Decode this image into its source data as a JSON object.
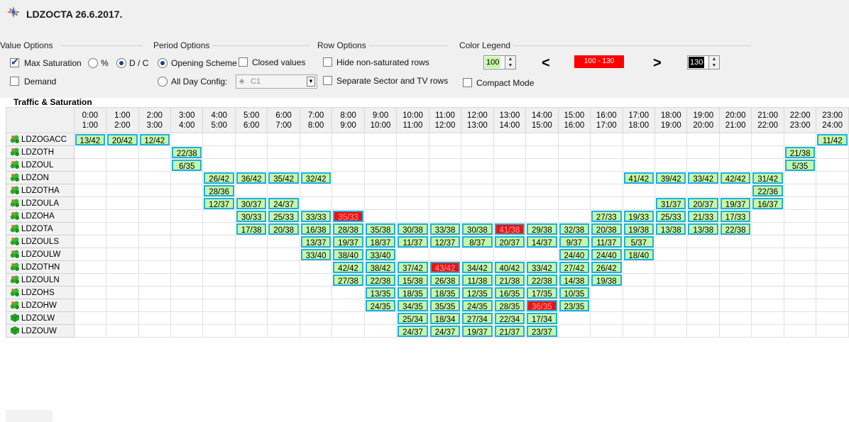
{
  "app": {
    "title": "LDZOCTA  26.6.2017."
  },
  "value_options": {
    "label": "Value Options",
    "max_saturation": "Max Saturation",
    "percent": "%",
    "dc": "D / C",
    "demand": "Demand"
  },
  "period_options": {
    "label": "Period Options",
    "opening_scheme": "Opening Scheme",
    "closed_values": "Closed values",
    "all_day_config": "All Day Config:",
    "config_value": "C1"
  },
  "row_options": {
    "label": "Row Options",
    "hide_rows": "Hide non-saturated rows",
    "separate_rows": "Separate Sector and TV rows"
  },
  "color_legend": {
    "label": "Color Legend",
    "low_value": "100",
    "less_than": "<",
    "range": "100 - 130",
    "greater_than": ">",
    "high_value": "130",
    "compact_mode": "Compact Mode",
    "cell_color": "#c6f7a9",
    "cell_border": "#19b1e0",
    "saturated_color": "#ee1111"
  },
  "table": {
    "title": "Traffic & Saturation",
    "hours": [
      [
        "0:00",
        "1:00"
      ],
      [
        "1:00",
        "2:00"
      ],
      [
        "2:00",
        "3:00"
      ],
      [
        "3:00",
        "4:00"
      ],
      [
        "4:00",
        "5:00"
      ],
      [
        "5:00",
        "6:00"
      ],
      [
        "6:00",
        "7:00"
      ],
      [
        "7:00",
        "8:00"
      ],
      [
        "8:00",
        "9:00"
      ],
      [
        "9:00",
        "10:00"
      ],
      [
        "10:00",
        "11:00"
      ],
      [
        "11:00",
        "12:00"
      ],
      [
        "12:00",
        "13:00"
      ],
      [
        "13:00",
        "14:00"
      ],
      [
        "14:00",
        "15:00"
      ],
      [
        "15:00",
        "16:00"
      ],
      [
        "16:00",
        "17:00"
      ],
      [
        "17:00",
        "18:00"
      ],
      [
        "18:00",
        "19:00"
      ],
      [
        "19:00",
        "20:00"
      ],
      [
        "20:00",
        "21:00"
      ],
      [
        "21:00",
        "22:00"
      ],
      [
        "22:00",
        "23:00"
      ],
      [
        "23:00",
        "24:00"
      ]
    ],
    "rows": [
      {
        "name": "LDZOGACC",
        "icon": "sector-group-icon",
        "cells": [
          "13/42",
          "20/42",
          "12/42",
          "",
          "",
          "",
          "",
          "",
          "",
          "",
          "",
          "",
          "",
          "",
          "",
          "",
          "",
          "",
          "",
          "",
          "",
          "",
          "",
          "11/42"
        ],
        "saturated": []
      },
      {
        "name": "LDZOTH",
        "icon": "sector-group-icon",
        "cells": [
          "",
          "",
          "",
          "22/38",
          "",
          "",
          "",
          "",
          "",
          "",
          "",
          "",
          "",
          "",
          "",
          "",
          "",
          "",
          "",
          "",
          "",
          "",
          "21/38",
          ""
        ],
        "saturated": []
      },
      {
        "name": "LDZOUL",
        "icon": "sector-group-icon",
        "cells": [
          "",
          "",
          "",
          "6/35",
          "",
          "",
          "",
          "",
          "",
          "",
          "",
          "",
          "",
          "",
          "",
          "",
          "",
          "",
          "",
          "",
          "",
          "",
          "5/35",
          ""
        ],
        "saturated": []
      },
      {
        "name": "LDZON",
        "icon": "sector-group-icon",
        "cells": [
          "",
          "",
          "",
          "",
          "26/42",
          "36/42",
          "35/42",
          "32/42",
          "",
          "",
          "",
          "",
          "",
          "",
          "",
          "",
          "",
          "41/42",
          "39/42",
          "33/42",
          "42/42",
          "31/42",
          "",
          ""
        ],
        "saturated": []
      },
      {
        "name": "LDZOTHA",
        "icon": "sector-group-icon",
        "cells": [
          "",
          "",
          "",
          "",
          "28/36",
          "",
          "",
          "",
          "",
          "",
          "",
          "",
          "",
          "",
          "",
          "",
          "",
          "",
          "",
          "",
          "",
          "22/36",
          "",
          ""
        ],
        "saturated": []
      },
      {
        "name": "LDZOULA",
        "icon": "sector-group-icon",
        "cells": [
          "",
          "",
          "",
          "",
          "12/37",
          "30/37",
          "24/37",
          "",
          "",
          "",
          "",
          "",
          "",
          "",
          "",
          "",
          "",
          "",
          "31/37",
          "20/37",
          "19/37",
          "16/37",
          "",
          ""
        ],
        "saturated": []
      },
      {
        "name": "LDZOHA",
        "icon": "sector-group-icon",
        "cells": [
          "",
          "",
          "",
          "",
          "",
          "30/33",
          "25/33",
          "33/33",
          "35/33",
          "",
          "",
          "",
          "",
          "",
          "",
          "",
          "27/33",
          "19/33",
          "25/33",
          "21/33",
          "17/33",
          "",
          "",
          ""
        ],
        "saturated": [
          8
        ]
      },
      {
        "name": "LDZOTA",
        "icon": "sector-group-icon",
        "cells": [
          "",
          "",
          "",
          "",
          "",
          "17/38",
          "20/38",
          "16/38",
          "28/38",
          "35/38",
          "30/38",
          "33/38",
          "30/38",
          "41/38",
          "29/38",
          "32/38",
          "20/38",
          "19/38",
          "13/38",
          "13/38",
          "22/38",
          "",
          "",
          ""
        ],
        "saturated": [
          13
        ]
      },
      {
        "name": "LDZOULS",
        "icon": "sector-group-icon",
        "cells": [
          "",
          "",
          "",
          "",
          "",
          "",
          "",
          "13/37",
          "19/37",
          "18/37",
          "11/37",
          "12/37",
          "8/37",
          "20/37",
          "14/37",
          "9/37",
          "11/37",
          "5/37",
          "",
          "",
          "",
          "",
          "",
          ""
        ],
        "saturated": []
      },
      {
        "name": "LDZOULW",
        "icon": "sector-group-icon",
        "cells": [
          "",
          "",
          "",
          "",
          "",
          "",
          "",
          "33/40",
          "38/40",
          "33/40",
          "",
          "",
          "",
          "",
          "",
          "24/40",
          "24/40",
          "18/40",
          "",
          "",
          "",
          "",
          "",
          ""
        ],
        "saturated": []
      },
      {
        "name": "LDZOTHN",
        "icon": "sector-group-icon",
        "cells": [
          "",
          "",
          "",
          "",
          "",
          "",
          "",
          "",
          "42/42",
          "38/42",
          "37/42",
          "43/42",
          "34/42",
          "40/42",
          "33/42",
          "27/42",
          "26/42",
          "",
          "",
          "",
          "",
          "",
          "",
          ""
        ],
        "saturated": [
          11
        ]
      },
      {
        "name": "LDZOULN",
        "icon": "sector-group-icon",
        "cells": [
          "",
          "",
          "",
          "",
          "",
          "",
          "",
          "",
          "27/38",
          "22/38",
          "15/38",
          "26/38",
          "11/38",
          "21/38",
          "22/38",
          "14/38",
          "19/38",
          "",
          "",
          "",
          "",
          "",
          "",
          ""
        ],
        "saturated": []
      },
      {
        "name": "LDZOHS",
        "icon": "sector-group-icon",
        "cells": [
          "",
          "",
          "",
          "",
          "",
          "",
          "",
          "",
          "",
          "13/35",
          "18/35",
          "18/35",
          "12/35",
          "16/35",
          "17/35",
          "10/35",
          "",
          "",
          "",
          "",
          "",
          "",
          "",
          ""
        ],
        "saturated": []
      },
      {
        "name": "LDZOHW",
        "icon": "sector-group-icon",
        "cells": [
          "",
          "",
          "",
          "",
          "",
          "",
          "",
          "",
          "",
          "24/35",
          "34/35",
          "35/35",
          "24/35",
          "28/35",
          "36/35",
          "23/35",
          "",
          "",
          "",
          "",
          "",
          "",
          "",
          ""
        ],
        "saturated": [
          14
        ]
      },
      {
        "name": "LDZOLW",
        "icon": "sector-cube-icon",
        "cells": [
          "",
          "",
          "",
          "",
          "",
          "",
          "",
          "",
          "",
          "",
          "25/34",
          "18/34",
          "27/34",
          "22/34",
          "17/34",
          "",
          "",
          "",
          "",
          "",
          "",
          "",
          "",
          ""
        ],
        "saturated": []
      },
      {
        "name": "LDZOUW",
        "icon": "sector-cube-icon",
        "cells": [
          "",
          "",
          "",
          "",
          "",
          "",
          "",
          "",
          "",
          "",
          "24/37",
          "24/37",
          "19/37",
          "21/37",
          "23/37",
          "",
          "",
          "",
          "",
          "",
          "",
          "",
          "",
          ""
        ],
        "saturated": []
      }
    ]
  }
}
